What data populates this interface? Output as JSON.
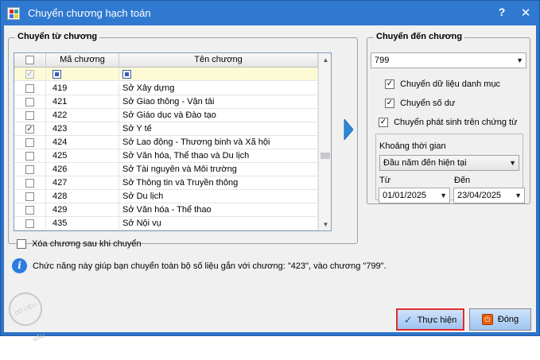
{
  "window": {
    "title": "Chuyển chương hạch toán",
    "help": "?",
    "close": "✕"
  },
  "left_group": {
    "label": "Chuyển từ chương",
    "columns": [
      "Mã chương",
      "Tên chương"
    ],
    "rows": [
      {
        "code": "419",
        "name": "Sở Xây dựng",
        "checked": false
      },
      {
        "code": "421",
        "name": "Sở Giao thông - Vận tải",
        "checked": false
      },
      {
        "code": "422",
        "name": "Sở Giáo dục và Đào tạo",
        "checked": false
      },
      {
        "code": "423",
        "name": "Sở Y tế",
        "checked": true
      },
      {
        "code": "424",
        "name": "Sở Lao động - Thương binh và Xã hội",
        "checked": false
      },
      {
        "code": "425",
        "name": "Sở Văn hóa, Thể thao và Du lịch",
        "checked": false
      },
      {
        "code": "426",
        "name": "Sở Tài nguyên và Môi trường",
        "checked": false
      },
      {
        "code": "427",
        "name": "Sở Thông tin và Truyền thông",
        "checked": false
      },
      {
        "code": "428",
        "name": "Sở Du lịch",
        "checked": false
      },
      {
        "code": "429",
        "name": "Sở Văn hóa - Thể thao",
        "checked": false
      },
      {
        "code": "435",
        "name": "Sở Nội vụ",
        "checked": false
      }
    ],
    "delete_after_label": "Xóa chương sau khi chuyển"
  },
  "right_group": {
    "label": "Chuyển đến chương",
    "target_chapter": "799",
    "options": [
      {
        "label": "Chuyển dữ liệu danh mục",
        "checked": true
      },
      {
        "label": "Chuyển số dư",
        "checked": true
      },
      {
        "label": "Chuyển phát sinh trên chứng từ",
        "checked": true
      }
    ],
    "period_label": "Khoảng thời gian",
    "period_value": "Đầu năm đến hiện tại",
    "from_label": "Từ",
    "from_value": "01/01/2025",
    "to_label": "Đến",
    "to_value": "23/04/2025"
  },
  "info": {
    "text": "Chức năng này giúp bạn chuyển toàn bộ số liệu gắn với  chương: \"423\",  vào chương \"799\"."
  },
  "watermark": "DỮ LIỆU MẪU",
  "buttons": {
    "execute": "Thực hiện",
    "close": "Đóng"
  },
  "colors": {
    "titlebar": "#3079d0",
    "filter_row": "#fcfbd6",
    "highlight_border": "#e02a2a"
  }
}
